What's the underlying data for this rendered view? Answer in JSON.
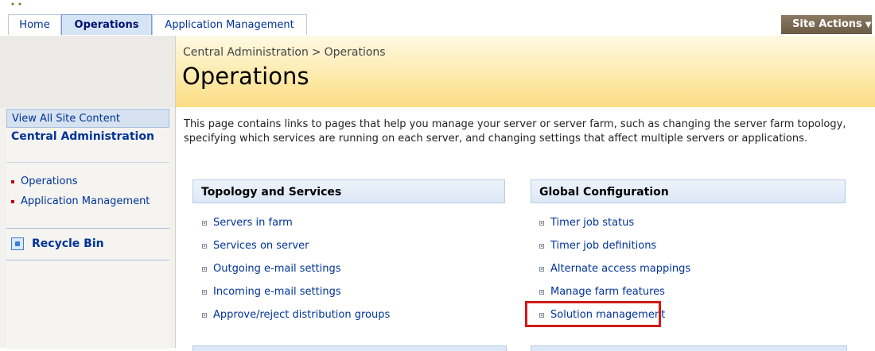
{
  "tabs": {
    "home": "Home",
    "operations": "Operations",
    "application_management": "Application Management"
  },
  "site_actions": {
    "label": "Site Actions",
    "caret": "▼"
  },
  "left_nav": {
    "view_all": "View All Site Content",
    "section_title": "Central Administration",
    "items": [
      {
        "label": "Operations"
      },
      {
        "label": "Application Management"
      }
    ],
    "recycle_bin": "Recycle Bin"
  },
  "header": {
    "breadcrumb": [
      "Central Administration",
      "Operations"
    ],
    "breadcrumb_sep": ">",
    "title": "Operations"
  },
  "intro": "This page contains links to pages that help you manage your server or server farm, such as changing the server farm topology, specifying which services are running on each server, and changing settings that affect multiple servers or applications.",
  "sections": [
    {
      "title": "Topology and Services",
      "links": [
        "Servers in farm",
        "Services on server",
        "Outgoing e-mail settings",
        "Incoming e-mail settings",
        "Approve/reject distribution groups"
      ]
    },
    {
      "title": "Global Configuration",
      "links": [
        "Timer job status",
        "Timer job definitions",
        "Alternate access mappings",
        "Manage farm features",
        "Solution management"
      ]
    }
  ],
  "colors": {
    "accent_link": "#003399",
    "highlight": "#d11a1a",
    "header_gold": "#fbdc83"
  }
}
